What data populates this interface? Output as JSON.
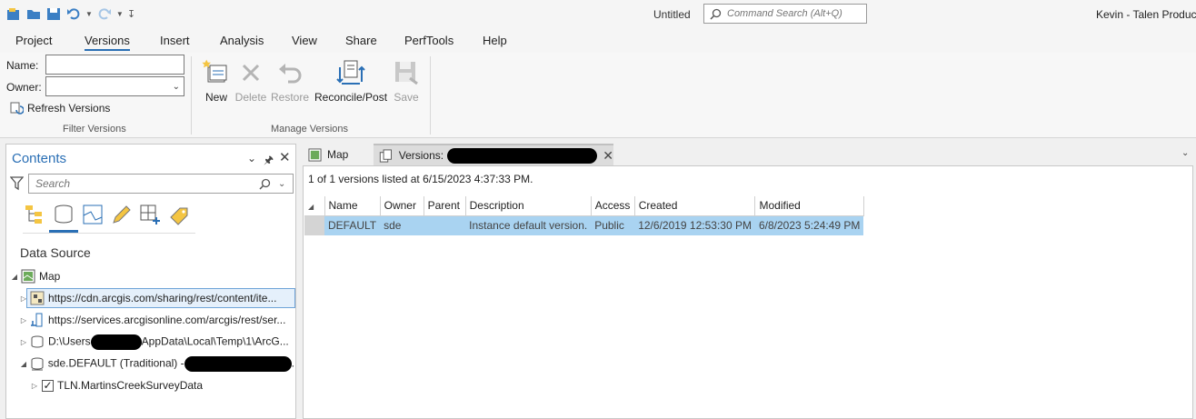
{
  "title_bar": {
    "document_title": "Untitled",
    "command_search_placeholder": "Command Search (Alt+Q)",
    "user": "Kevin - Talen Product"
  },
  "ribbon_tabs": [
    {
      "label": "Project"
    },
    {
      "label": "Versions",
      "active": true
    },
    {
      "label": "Insert"
    },
    {
      "label": "Analysis"
    },
    {
      "label": "View"
    },
    {
      "label": "Share"
    },
    {
      "label": "PerfTools"
    },
    {
      "label": "Help"
    }
  ],
  "filter_versions": {
    "name_label": "Name:",
    "name_value": "",
    "owner_label": "Owner:",
    "owner_value": "",
    "refresh_label": "Refresh Versions",
    "group_label": "Filter Versions"
  },
  "manage_versions": {
    "buttons": [
      {
        "label": "New",
        "enabled": true
      },
      {
        "label": "Delete",
        "enabled": false
      },
      {
        "label": "Restore",
        "enabled": false
      },
      {
        "label": "Reconcile/Post",
        "enabled": true
      },
      {
        "label": "Save",
        "enabled": false
      }
    ],
    "group_label": "Manage Versions"
  },
  "contents": {
    "title": "Contents",
    "search_placeholder": "Search",
    "heading": "Data Source",
    "tree": [
      {
        "text": "Map",
        "level": 0,
        "expanded": true
      },
      {
        "text": "https://cdn.arcgis.com/sharing/rest/content/ite...",
        "level": 1,
        "selected": true
      },
      {
        "text": "https://services.arcgisonline.com/arcgis/rest/ser...",
        "level": 1
      },
      {
        "text_before": "D:\\Users",
        "text_after": "AppData\\Local\\Temp\\1\\ArcG...",
        "level": 1
      },
      {
        "text_before": "sde.DEFAULT (Traditional) -",
        "text_after": "...",
        "level": 1,
        "expanded": true
      },
      {
        "text": "TLN.MartinsCreekSurveyData",
        "level": 2,
        "checked": true
      }
    ]
  },
  "doc_tabs": [
    {
      "label": "Map"
    },
    {
      "label": "Versions:",
      "active": true
    }
  ],
  "versions_view": {
    "listed_text": "1 of 1 versions listed at 6/15/2023 4:37:33 PM.",
    "columns": [
      "Name",
      "Owner",
      "Parent",
      "Description",
      "Access",
      "Created",
      "Modified"
    ],
    "rows": [
      [
        "DEFAULT",
        "sde",
        "",
        "Instance default version.",
        "Public",
        "12/6/2019 12:53:30 PM",
        "6/8/2023 5:24:49 PM"
      ]
    ]
  },
  "colors": {
    "accent": "#2a6fb5",
    "selected_row": "#a9d3f1"
  }
}
